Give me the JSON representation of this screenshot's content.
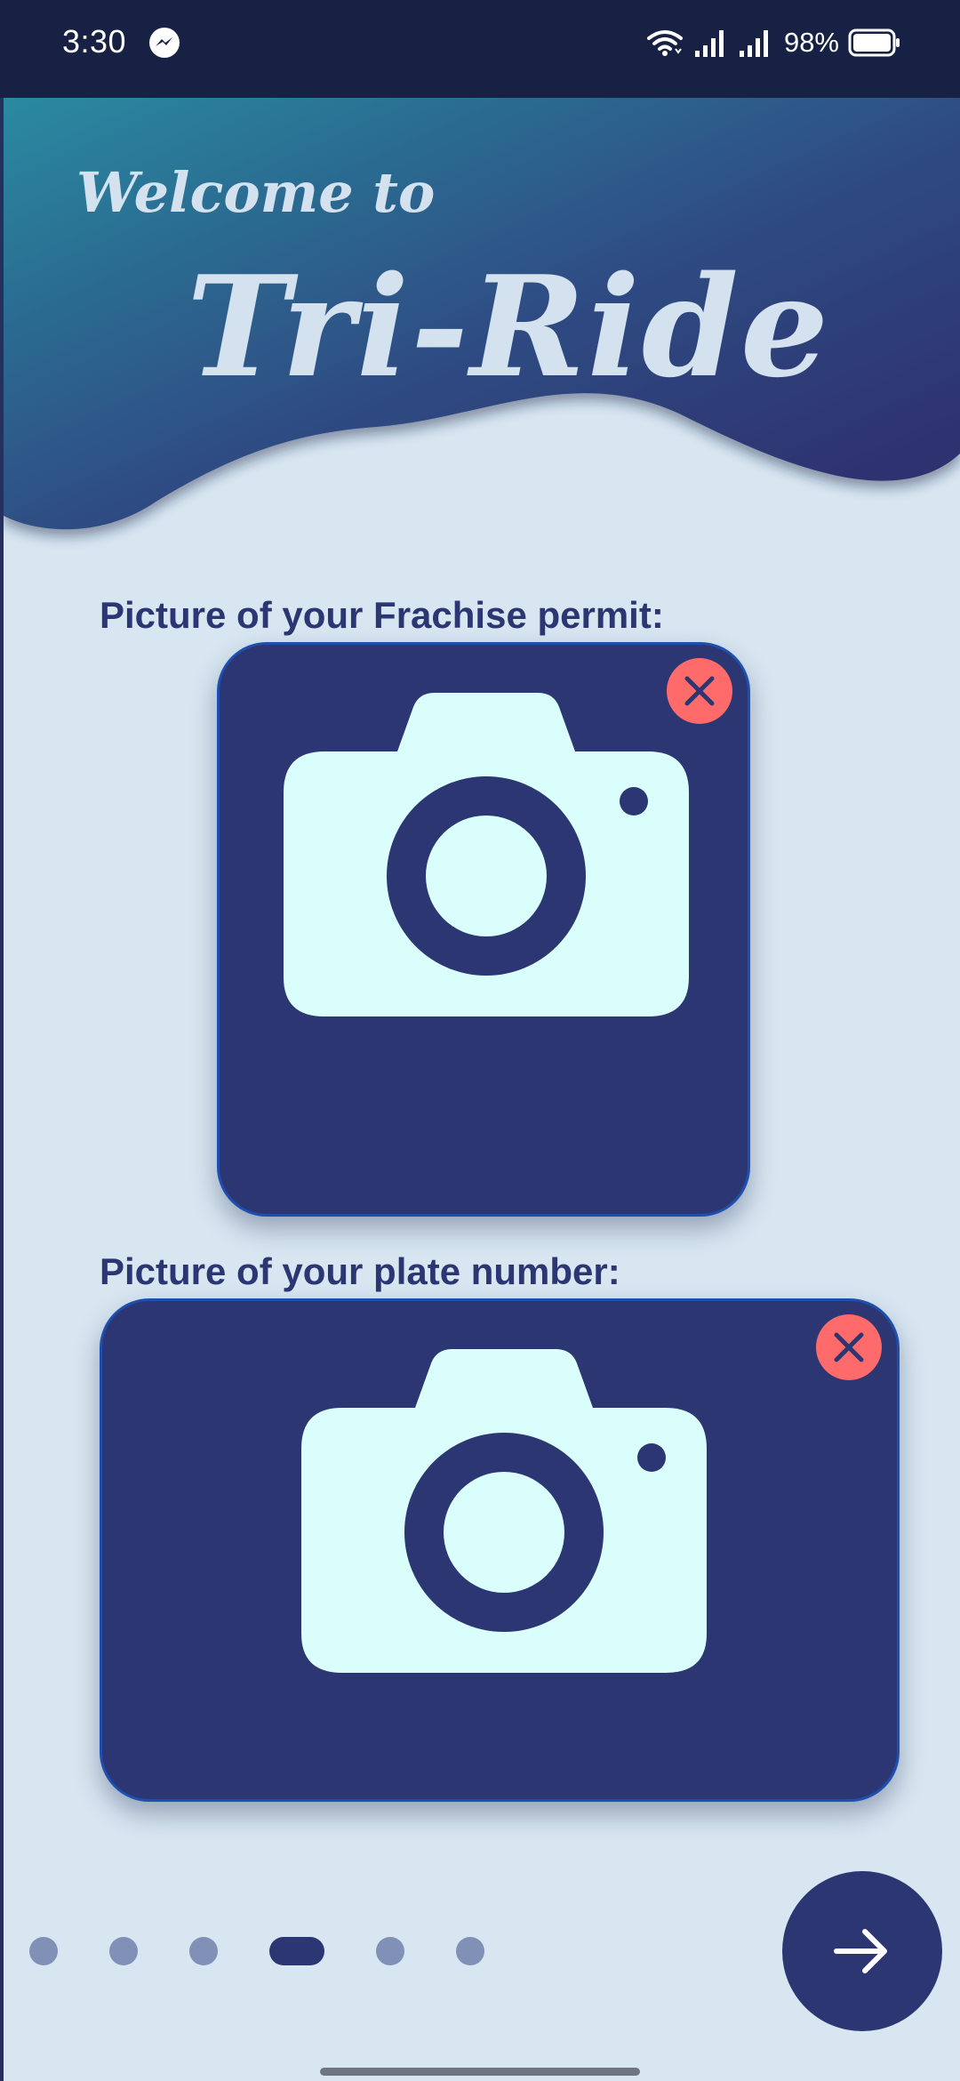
{
  "status_bar": {
    "time": "3:30",
    "battery": "98%",
    "icons": [
      "messenger-icon",
      "wifi-icon",
      "signal-icon",
      "signal-icon",
      "battery-icon"
    ]
  },
  "header": {
    "welcome_text": "Welcome to",
    "app_name": "Tri-Ride",
    "gradient": [
      "#2a8aa0",
      "#2e3f7c",
      "#2f2a6a"
    ]
  },
  "sections": [
    {
      "label": "Picture of your Frachise permit:",
      "icon": "camera-icon",
      "remove_icon": "close-icon"
    },
    {
      "label": "Picture of your plate number:",
      "icon": "camera-icon",
      "remove_icon": "close-icon"
    }
  ],
  "pager": {
    "total": 6,
    "active_index": 3
  },
  "next_button": {
    "icon": "arrow-right-icon"
  },
  "colors": {
    "background": "#d7e6f1",
    "primary": "#2b3672",
    "status_bar": "#172143",
    "remove": "#ff6b6b",
    "camera": "#d9fefb",
    "dot_inactive": "#8090b7"
  }
}
